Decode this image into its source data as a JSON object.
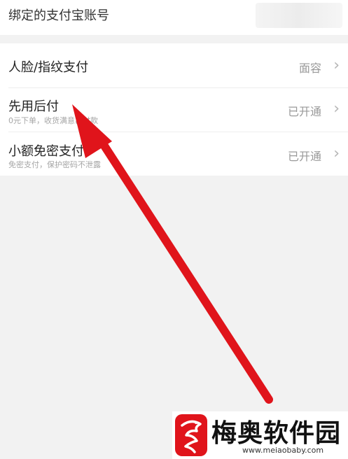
{
  "top": {
    "label": "绑定的支付宝账号"
  },
  "settings": [
    {
      "label": "人脸/指纹支付",
      "sublabel": "",
      "value": "面容"
    },
    {
      "label": "先用后付",
      "sublabel": "0元下单，收货满意再付款",
      "value": "已开通"
    },
    {
      "label": "小额免密支付",
      "sublabel": "免密支付，保护密码不泄露",
      "value": "已开通"
    }
  ],
  "icons": {
    "chevron": "chevron-right-icon",
    "arrow": "red-arrow-annotation",
    "logo": "dragon-logo-icon"
  },
  "colors": {
    "arrow": "#e0141b",
    "logo": "#e0141b",
    "background": "#f2f2f2"
  },
  "watermark": {
    "title": "梅奥软件园",
    "url": "www.meiaobaby.com"
  }
}
